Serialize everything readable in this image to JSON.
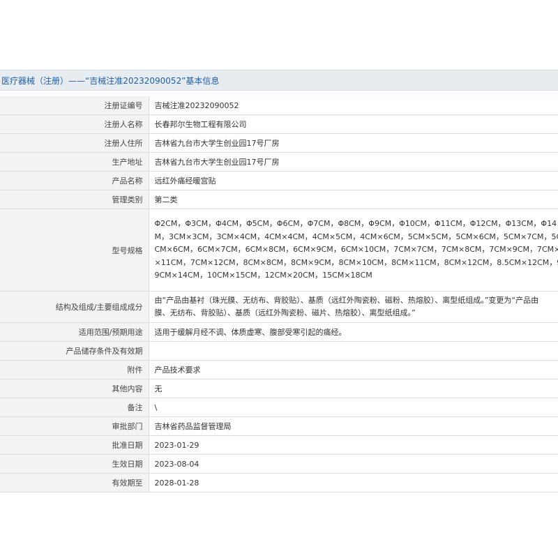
{
  "title": "医疗器械（注册）——“吉械注准20232090052”基本信息",
  "rows": [
    {
      "label": "注册证编号",
      "value": "吉械注准20232090052"
    },
    {
      "label": "注册人名称",
      "value": "长春邦尔生物工程有限公司"
    },
    {
      "label": "注册人住所",
      "value": "吉林省九台市大学生创业园17号厂房"
    },
    {
      "label": "生产地址",
      "value": "吉林省九台市大学生创业园17号厂房"
    },
    {
      "label": "产品名称",
      "value": "远红外痛经暖宫贴"
    },
    {
      "label": "管理类别",
      "value": "第二类"
    }
  ],
  "model": {
    "label": "型号规格",
    "lines": [
      "Φ2CM，Φ3CM，Φ4CM，Φ5CM，Φ6CM，Φ7CM，Φ8CM，Φ9CM，Φ10CM，Φ11CM，Φ12CM，Φ13CM，Φ14",
      "M，3CM×3CM，3CM×4CM，4CM×4CM，4CM×5CM，4CM×6CM，5CM×5CM，5CM×6CM，5CM×7CM，5C",
      "CM×6CM，6CM×7CM，6CM×8CM，6CM×9CM，6CM×10CM，7CM×7CM，7CM×8CM，7CM×9CM，7CM×",
      "×11CM，7CM×12CM，8CM×8CM，8CM×9CM，8CM×10CM，8CM×11CM，8CM×12CM，8.5CM×12CM，9C",
      "9CM×14CM，10CM×15CM，12CM×20CM，15CM×18CM"
    ]
  },
  "structure": {
    "label": "结构及组成/主要组成成分",
    "lines": [
      "由“产品由基衬（珠光膜、无纺布、背胶贴）、基质（远红外陶瓷粉、磁粉、热熔胶）、离型纸组成。”变更为“产品由",
      "膜、无纺布、背胶贴）、基质（远红外陶瓷粉、磁片、热熔胶）、离型纸组成。”"
    ]
  },
  "rows2": [
    {
      "label": "适用范围/预期用途",
      "value": "适用于缓解月经不调、体质虚寒、腹部受寒引起的痛经。"
    },
    {
      "label": "产品储存条件及有效期",
      "value": ""
    },
    {
      "label": "附件",
      "value": "产品技术要求"
    },
    {
      "label": "其他内容",
      "value": "无"
    },
    {
      "label": "备注",
      "value": "\\"
    },
    {
      "label": "审批部门",
      "value": "吉林省药品监督管理局"
    },
    {
      "label": "批准日期",
      "value": "2023-01-29"
    },
    {
      "label": "生效日期",
      "value": "2023-08-04"
    },
    {
      "label": "有效期至",
      "value": "2028-01-28"
    }
  ]
}
